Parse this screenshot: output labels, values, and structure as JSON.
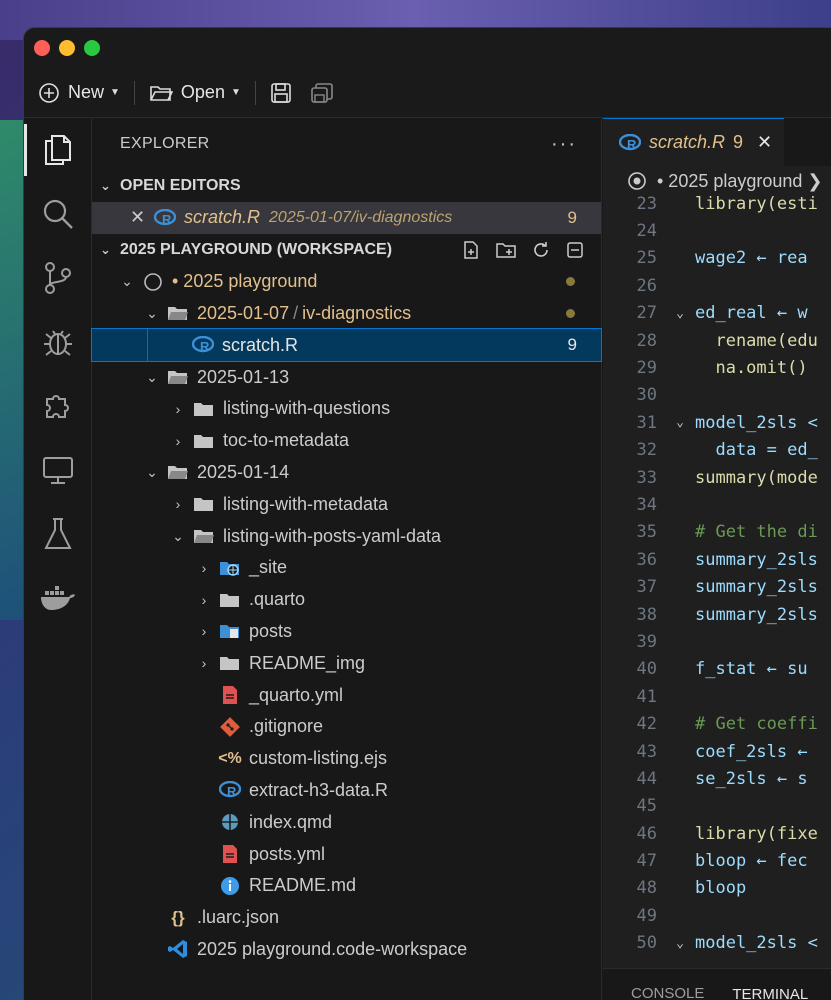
{
  "toolbar": {
    "new_label": "New",
    "open_label": "Open"
  },
  "sidebar": {
    "title": "EXPLORER",
    "open_editors": {
      "header": "OPEN EDITORS",
      "item": {
        "name": "scratch.R",
        "path": "2025-01-07/iv-diagnostics",
        "count": "9"
      }
    },
    "workspace": {
      "header": "2025 PLAYGROUND (WORKSPACE)",
      "root": "• 2025 playground",
      "folder_a": "2025-01-07",
      "folder_a_sub": "iv-diagnostics",
      "scratch": "scratch.R",
      "scratch_count": "9",
      "folder_b": "2025-01-13",
      "b1": "listing-with-questions",
      "b2": "toc-to-metadata",
      "folder_c": "2025-01-14",
      "c1": "listing-with-metadata",
      "c2": "listing-with-posts-yaml-data",
      "c2_items": {
        "site": "_site",
        "quarto": ".quarto",
        "posts": "posts",
        "readme_img": "README_img",
        "quarto_yml": "_quarto.yml",
        "gitignore": ".gitignore",
        "custom_listing": "custom-listing.ejs",
        "extract": "extract-h3-data.R",
        "index": "index.qmd",
        "posts_yml": "posts.yml",
        "readme": "README.md"
      },
      "luarc": ".luarc.json",
      "workspace_file": "2025 playground.code-workspace"
    }
  },
  "editor": {
    "tab": {
      "name": "scratch.R",
      "count": "9"
    },
    "breadcrumb": "• 2025 playground ❯",
    "lines": [
      {
        "n": "23",
        "t": "library(esti",
        "c": "fn"
      },
      {
        "n": "24",
        "t": "",
        "c": "plain"
      },
      {
        "n": "25",
        "t": "wage2 ← rea",
        "c": "src"
      },
      {
        "n": "26",
        "t": "",
        "c": "plain"
      },
      {
        "n": "27",
        "t": "ed_real ← w",
        "c": "src"
      },
      {
        "n": "28",
        "t": "  rename(edu",
        "c": "fn"
      },
      {
        "n": "29",
        "t": "  na.omit()",
        "c": "fn"
      },
      {
        "n": "30",
        "t": "",
        "c": "plain"
      },
      {
        "n": "31",
        "t": "model_2sls <",
        "c": "src"
      },
      {
        "n": "32",
        "t": "  data = ed_",
        "c": "src"
      },
      {
        "n": "33",
        "t": "summary(mode",
        "c": "fn"
      },
      {
        "n": "34",
        "t": "",
        "c": "plain"
      },
      {
        "n": "35",
        "t": "# Get the di",
        "c": "comment"
      },
      {
        "n": "36",
        "t": "summary_2sls",
        "c": "src"
      },
      {
        "n": "37",
        "t": "summary_2sls",
        "c": "src"
      },
      {
        "n": "38",
        "t": "summary_2sls",
        "c": "src"
      },
      {
        "n": "39",
        "t": "",
        "c": "plain"
      },
      {
        "n": "40",
        "t": "f_stat ← su",
        "c": "src"
      },
      {
        "n": "41",
        "t": "",
        "c": "plain"
      },
      {
        "n": "42",
        "t": "# Get coeffi",
        "c": "comment"
      },
      {
        "n": "43",
        "t": "coef_2sls ←",
        "c": "src"
      },
      {
        "n": "44",
        "t": "se_2sls ← s",
        "c": "src"
      },
      {
        "n": "45",
        "t": "",
        "c": "plain"
      },
      {
        "n": "46",
        "t": "library(fixe",
        "c": "fn"
      },
      {
        "n": "47",
        "t": "bloop ← fec",
        "c": "src"
      },
      {
        "n": "48",
        "t": "bloop",
        "c": "src"
      },
      {
        "n": "49",
        "t": "",
        "c": "plain"
      },
      {
        "n": "50",
        "t": "model_2sls <",
        "c": "src"
      }
    ]
  },
  "panel": {
    "console": "CONSOLE",
    "terminal": "TERMINAL"
  }
}
